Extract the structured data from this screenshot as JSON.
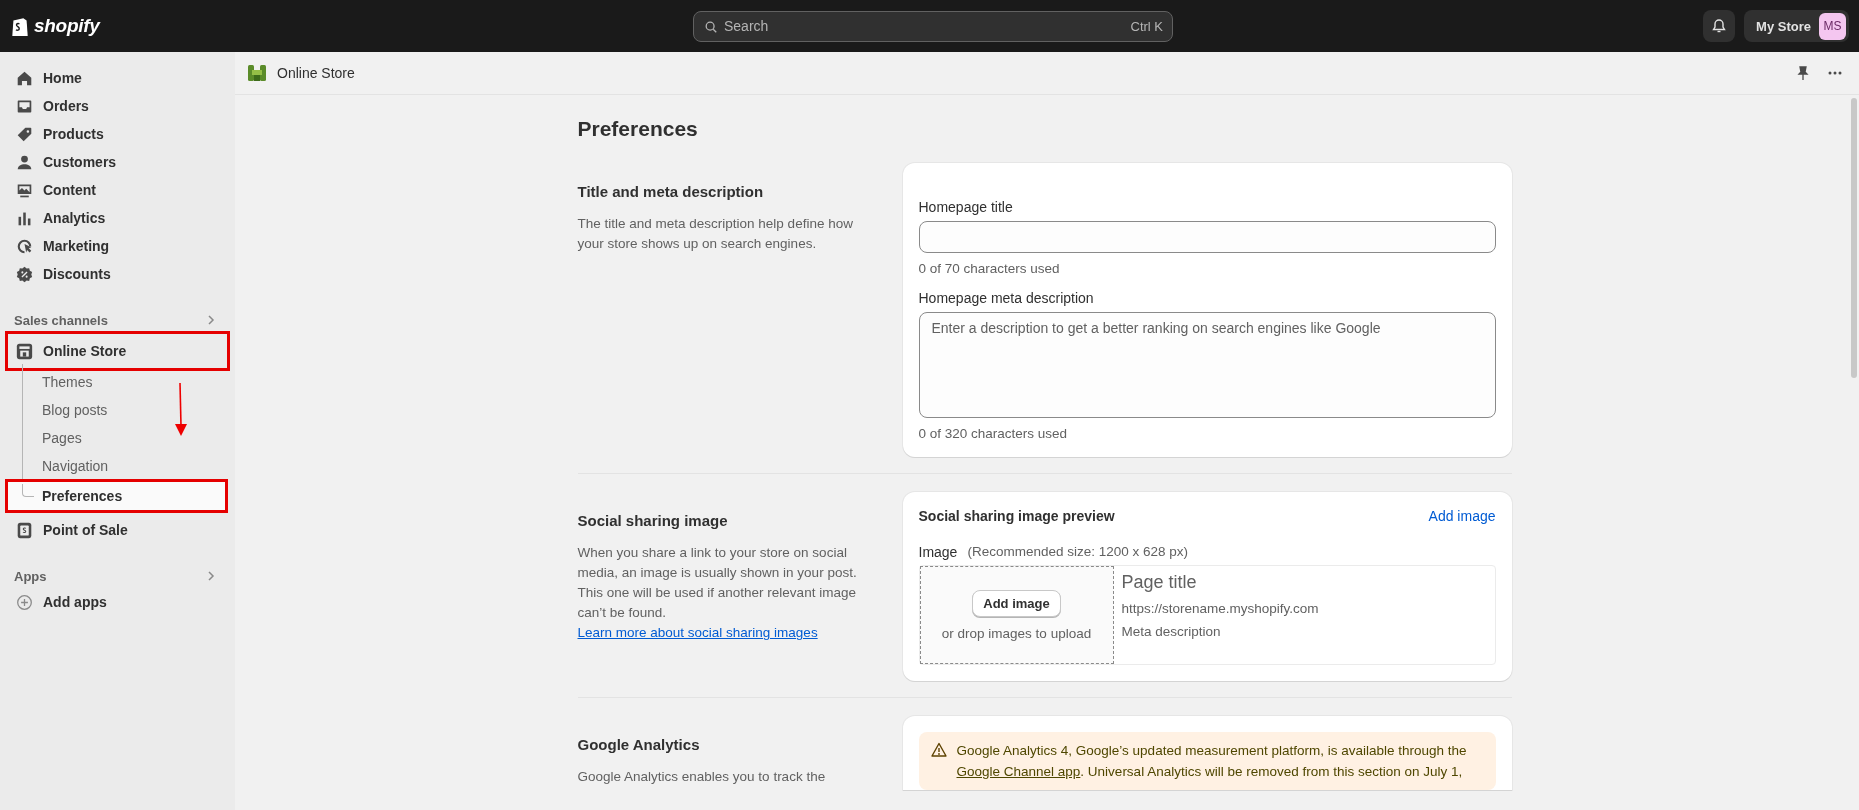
{
  "topbar": {
    "logo": "shopify",
    "search": {
      "placeholder": "Search",
      "shortcut": "Ctrl K"
    },
    "store": {
      "label": "My Store",
      "initials": "MS"
    }
  },
  "sidebar": {
    "items": [
      {
        "label": "Home"
      },
      {
        "label": "Orders"
      },
      {
        "label": "Products"
      },
      {
        "label": "Customers"
      },
      {
        "label": "Content"
      },
      {
        "label": "Analytics"
      },
      {
        "label": "Marketing"
      },
      {
        "label": "Discounts"
      }
    ],
    "sections": [
      {
        "title": "Sales channels",
        "items": [
          {
            "label": "Online Store",
            "highlighted": true,
            "children": [
              {
                "label": "Themes",
                "selected": false,
                "highlighted": false
              },
              {
                "label": "Blog posts",
                "selected": false,
                "highlighted": false
              },
              {
                "label": "Pages",
                "selected": false,
                "highlighted": false
              },
              {
                "label": "Navigation",
                "selected": false,
                "highlighted": false
              },
              {
                "label": "Preferences",
                "selected": true,
                "highlighted": true
              }
            ]
          },
          {
            "label": "Point of Sale",
            "highlighted": false
          }
        ]
      },
      {
        "title": "Apps",
        "items": [
          {
            "label": "Add apps",
            "highlighted": false
          }
        ]
      }
    ],
    "annotation_arrow": true
  },
  "page_header": {
    "title": "Online Store"
  },
  "page": {
    "title": "Preferences",
    "sections": [
      {
        "kind": "meta",
        "title": "Title and meta description",
        "description": "The title and meta description help define how your store shows up on search engines.",
        "fields": [
          {
            "kind": "input",
            "label": "Homepage title",
            "counter": "0 of 70 characters used"
          },
          {
            "kind": "textarea",
            "label": "Homepage meta description",
            "placeholder": "Enter a description to get a better ranking on search engines like Google",
            "counter": "0 of 320 characters used"
          }
        ]
      },
      {
        "kind": "social",
        "title": "Social sharing image",
        "description": "When you share a link to your store on social media, an image is usually shown in your post. This one will be used if another relevant image can’t be found.",
        "link": "Learn more about social sharing images",
        "card_title": "Social sharing image preview",
        "card_action": "Add image",
        "image_label": "Image",
        "image_hint": "(Recommended size: 1200 x 628 px)",
        "upload_button": "Add image",
        "drop_text": "or drop images to upload",
        "preview": {
          "title": "Page title",
          "url": "https://storename.myshopify.com",
          "meta": "Meta description"
        }
      },
      {
        "kind": "analytics",
        "title": "Google Analytics",
        "description": "Google Analytics enables you to track the",
        "banner": {
          "text_before": "Google Analytics 4, Google’s updated measurement platform, is available through the",
          "link": "Google Channel app",
          "text_after": ". Universal Analytics will be removed from this section on July 1,"
        }
      }
    ]
  }
}
